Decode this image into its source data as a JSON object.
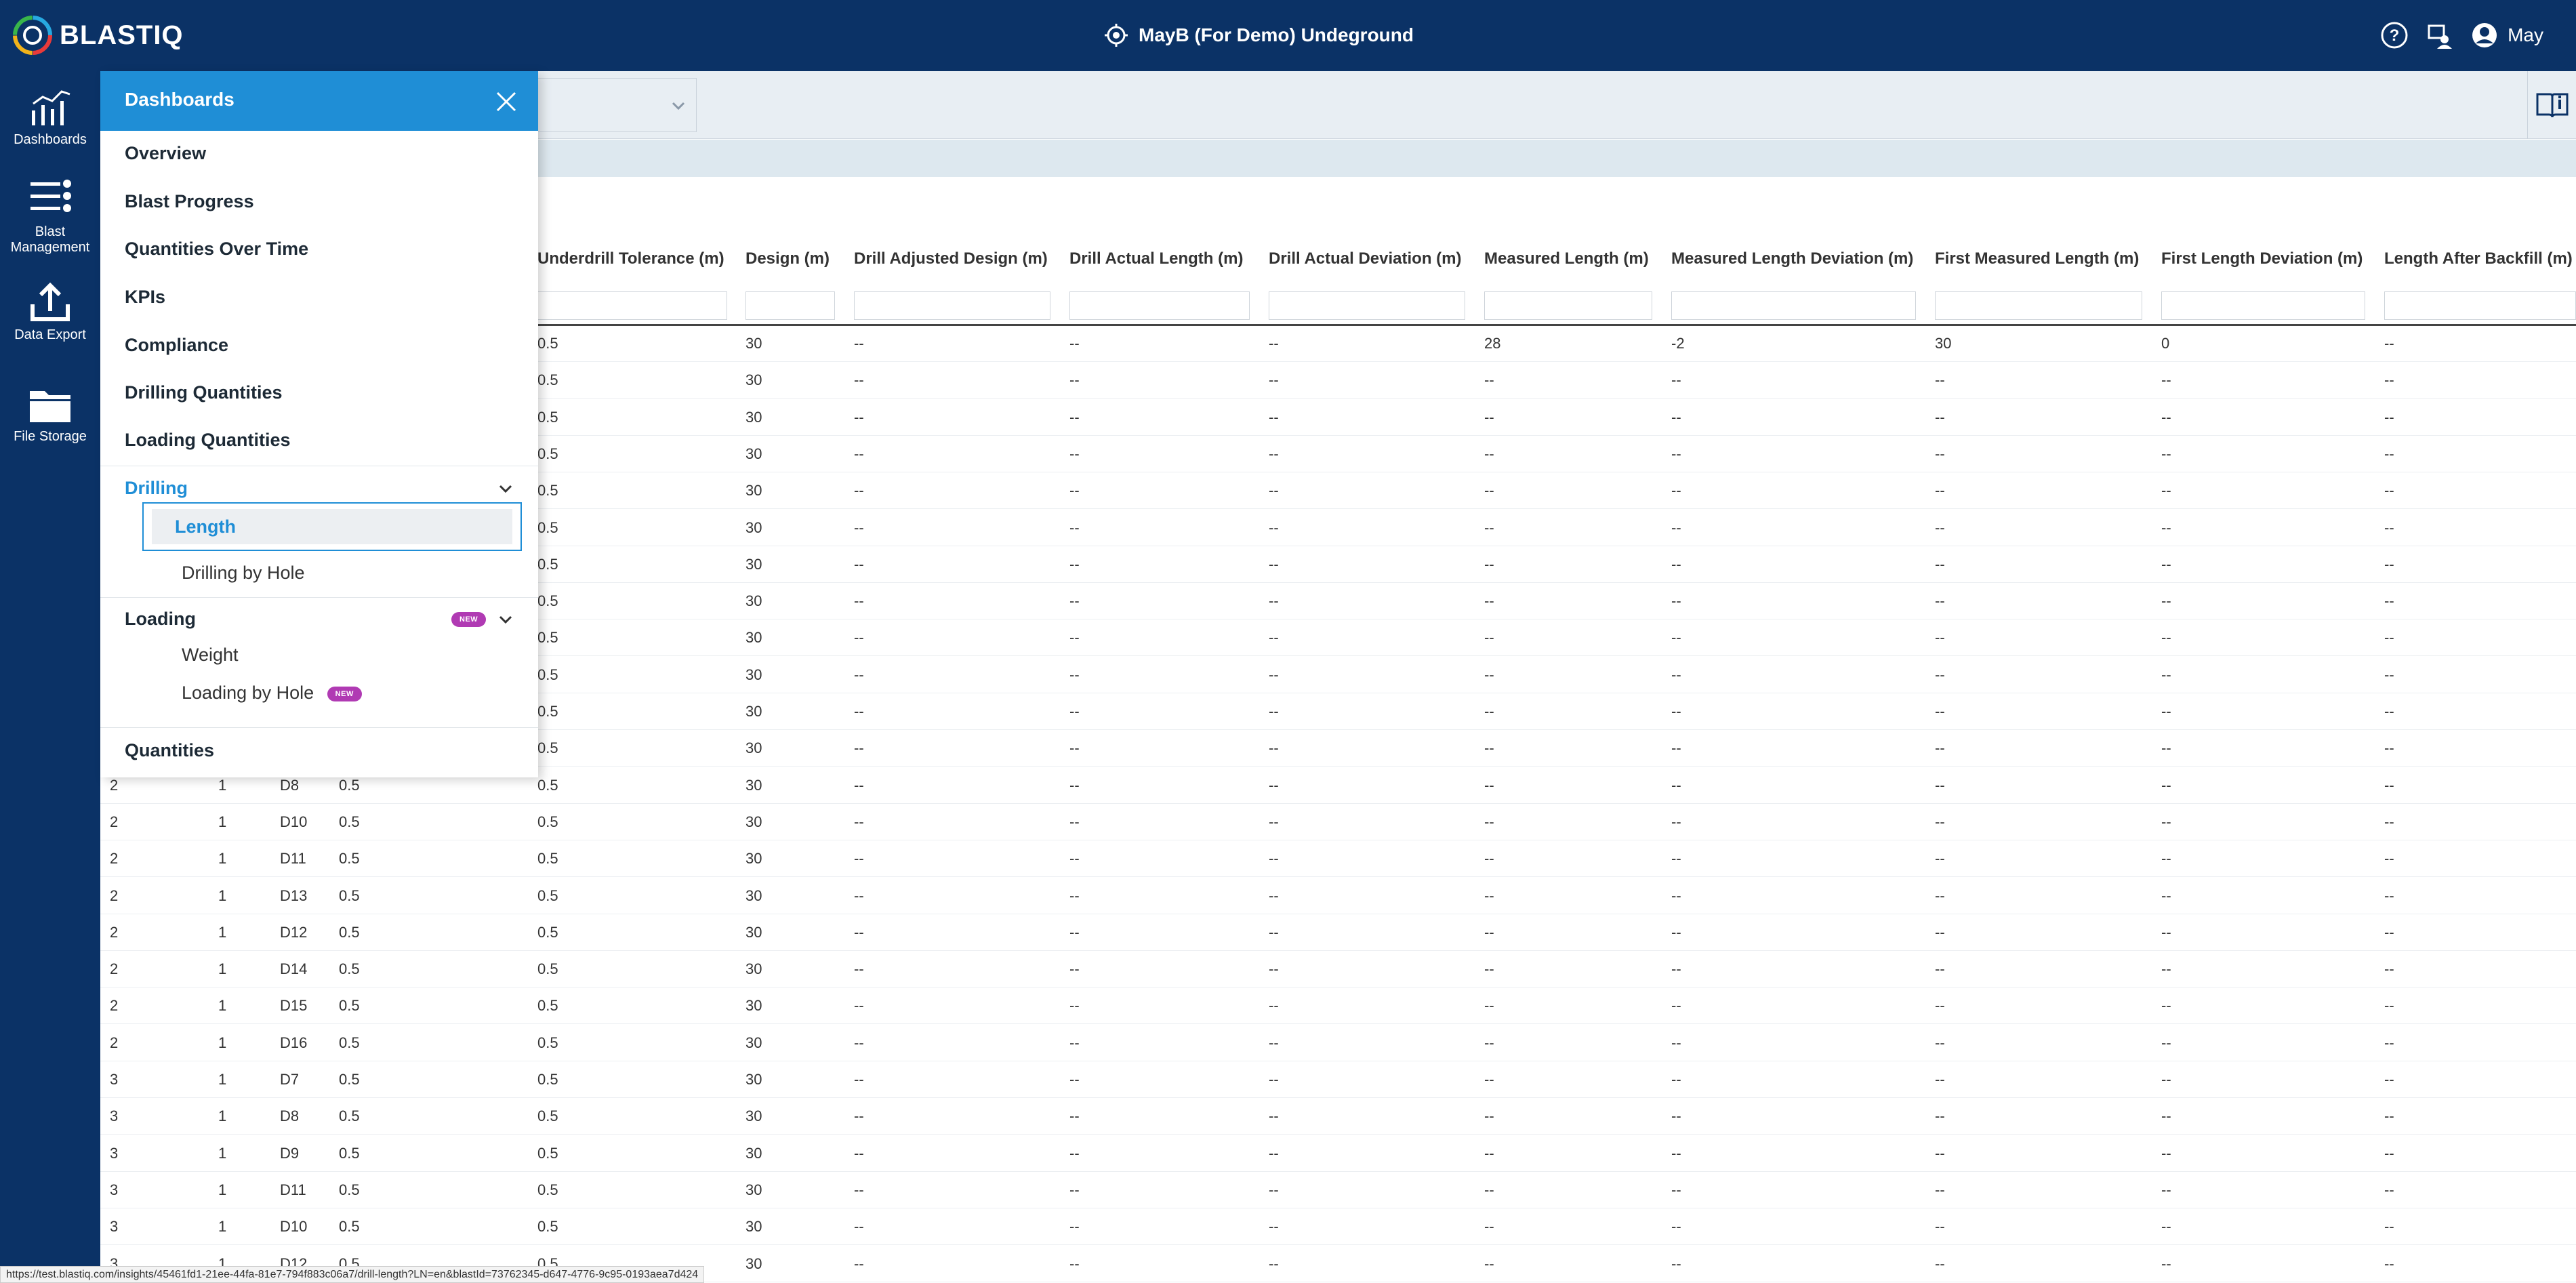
{
  "header": {
    "logo_text": "BLASTIQ",
    "site_name": "MayB (For Demo) Undeground",
    "user_name": "May"
  },
  "rail": {
    "items": [
      {
        "label": "Dashboards"
      },
      {
        "label": "Blast Management"
      },
      {
        "label": "Data Export"
      },
      {
        "label": "File Storage"
      }
    ]
  },
  "panel": {
    "title": "Dashboards",
    "items": {
      "overview": "Overview",
      "blast_progress": "Blast Progress",
      "quantities_over_time": "Quantities Over Time",
      "kpis": "KPIs",
      "compliance": "Compliance",
      "drilling_quantities": "Drilling Quantities",
      "loading_quantities": "Loading Quantities",
      "drilling": "Drilling",
      "length": "Length",
      "drilling_by_hole": "Drilling by Hole",
      "loading": "Loading",
      "weight": "Weight",
      "loading_by_hole": "Loading by Hole",
      "quantities": "Quantities"
    },
    "badge": "NEW"
  },
  "table": {
    "columns": [
      "Underdrill Tolerance (m)",
      "Design (m)",
      "Drill Adjusted Design (m)",
      "Drill Actual Length (m)",
      "Drill Actual Deviation (m)",
      "Measured Length (m)",
      "Measured Length Deviation (m)",
      "First Measured Length (m)",
      "First Length Deviation (m)",
      "Length After Backfill (m)"
    ],
    "rows": [
      {
        "a": "",
        "b": "",
        "c": "",
        "d": "",
        "u": "0.5",
        "v": [
          "30",
          "--",
          "--",
          "--",
          "28",
          "-2",
          "30",
          "0",
          "--"
        ]
      },
      {
        "a": "",
        "b": "",
        "c": "",
        "d": "",
        "u": "0.5",
        "v": [
          "30",
          "--",
          "--",
          "--",
          "--",
          "--",
          "--",
          "--",
          "--"
        ]
      },
      {
        "a": "",
        "b": "",
        "c": "",
        "d": "",
        "u": "0.5",
        "v": [
          "30",
          "--",
          "--",
          "--",
          "--",
          "--",
          "--",
          "--",
          "--"
        ]
      },
      {
        "a": "",
        "b": "",
        "c": "",
        "d": "",
        "u": "0.5",
        "v": [
          "30",
          "--",
          "--",
          "--",
          "--",
          "--",
          "--",
          "--",
          "--"
        ]
      },
      {
        "a": "",
        "b": "",
        "c": "",
        "d": "",
        "u": "0.5",
        "v": [
          "30",
          "--",
          "--",
          "--",
          "--",
          "--",
          "--",
          "--",
          "--"
        ]
      },
      {
        "a": "",
        "b": "",
        "c": "",
        "d": "",
        "u": "0.5",
        "v": [
          "30",
          "--",
          "--",
          "--",
          "--",
          "--",
          "--",
          "--",
          "--"
        ]
      },
      {
        "a": "",
        "b": "",
        "c": "",
        "d": "",
        "u": "0.5",
        "v": [
          "30",
          "--",
          "--",
          "--",
          "--",
          "--",
          "--",
          "--",
          "--"
        ]
      },
      {
        "a": "",
        "b": "",
        "c": "",
        "d": "",
        "u": "0.5",
        "v": [
          "30",
          "--",
          "--",
          "--",
          "--",
          "--",
          "--",
          "--",
          "--"
        ]
      },
      {
        "a": "",
        "b": "",
        "c": "",
        "d": "",
        "u": "0.5",
        "v": [
          "30",
          "--",
          "--",
          "--",
          "--",
          "--",
          "--",
          "--",
          "--"
        ]
      },
      {
        "a": "",
        "b": "",
        "c": "",
        "d": "",
        "u": "0.5",
        "v": [
          "30",
          "--",
          "--",
          "--",
          "--",
          "--",
          "--",
          "--",
          "--"
        ]
      },
      {
        "a": "",
        "b": "",
        "c": "",
        "d": "",
        "u": "0.5",
        "v": [
          "30",
          "--",
          "--",
          "--",
          "--",
          "--",
          "--",
          "--",
          "--"
        ]
      },
      {
        "a": "",
        "b": "",
        "c": "",
        "d": "",
        "u": "0.5",
        "v": [
          "30",
          "--",
          "--",
          "--",
          "--",
          "--",
          "--",
          "--",
          "--"
        ]
      },
      {
        "a": "2",
        "b": "1",
        "c": "D8",
        "d": "0.5",
        "u": "0.5",
        "v": [
          "30",
          "--",
          "--",
          "--",
          "--",
          "--",
          "--",
          "--",
          "--"
        ]
      },
      {
        "a": "2",
        "b": "1",
        "c": "D10",
        "d": "0.5",
        "u": "0.5",
        "v": [
          "30",
          "--",
          "--",
          "--",
          "--",
          "--",
          "--",
          "--",
          "--"
        ]
      },
      {
        "a": "2",
        "b": "1",
        "c": "D11",
        "d": "0.5",
        "u": "0.5",
        "v": [
          "30",
          "--",
          "--",
          "--",
          "--",
          "--",
          "--",
          "--",
          "--"
        ]
      },
      {
        "a": "2",
        "b": "1",
        "c": "D13",
        "d": "0.5",
        "u": "0.5",
        "v": [
          "30",
          "--",
          "--",
          "--",
          "--",
          "--",
          "--",
          "--",
          "--"
        ]
      },
      {
        "a": "2",
        "b": "1",
        "c": "D12",
        "d": "0.5",
        "u": "0.5",
        "v": [
          "30",
          "--",
          "--",
          "--",
          "--",
          "--",
          "--",
          "--",
          "--"
        ]
      },
      {
        "a": "2",
        "b": "1",
        "c": "D14",
        "d": "0.5",
        "u": "0.5",
        "v": [
          "30",
          "--",
          "--",
          "--",
          "--",
          "--",
          "--",
          "--",
          "--"
        ]
      },
      {
        "a": "2",
        "b": "1",
        "c": "D15",
        "d": "0.5",
        "u": "0.5",
        "v": [
          "30",
          "--",
          "--",
          "--",
          "--",
          "--",
          "--",
          "--",
          "--"
        ]
      },
      {
        "a": "2",
        "b": "1",
        "c": "D16",
        "d": "0.5",
        "u": "0.5",
        "v": [
          "30",
          "--",
          "--",
          "--",
          "--",
          "--",
          "--",
          "--",
          "--"
        ]
      },
      {
        "a": "3",
        "b": "1",
        "c": "D7",
        "d": "0.5",
        "u": "0.5",
        "v": [
          "30",
          "--",
          "--",
          "--",
          "--",
          "--",
          "--",
          "--",
          "--"
        ]
      },
      {
        "a": "3",
        "b": "1",
        "c": "D8",
        "d": "0.5",
        "u": "0.5",
        "v": [
          "30",
          "--",
          "--",
          "--",
          "--",
          "--",
          "--",
          "--",
          "--"
        ]
      },
      {
        "a": "3",
        "b": "1",
        "c": "D9",
        "d": "0.5",
        "u": "0.5",
        "v": [
          "30",
          "--",
          "--",
          "--",
          "--",
          "--",
          "--",
          "--",
          "--"
        ]
      },
      {
        "a": "3",
        "b": "1",
        "c": "D11",
        "d": "0.5",
        "u": "0.5",
        "v": [
          "30",
          "--",
          "--",
          "--",
          "--",
          "--",
          "--",
          "--",
          "--"
        ]
      },
      {
        "a": "3",
        "b": "1",
        "c": "D10",
        "d": "0.5",
        "u": "0.5",
        "v": [
          "30",
          "--",
          "--",
          "--",
          "--",
          "--",
          "--",
          "--",
          "--"
        ]
      },
      {
        "a": "3",
        "b": "1",
        "c": "D12",
        "d": "0.5",
        "u": "0.5",
        "v": [
          "30",
          "--",
          "--",
          "--",
          "--",
          "--",
          "--",
          "--",
          "--"
        ]
      }
    ]
  },
  "status_url": "https://test.blastiq.com/insights/45461fd1-21ee-44fa-81e7-794f883c06a7/drill-length?LN=en&blastId=73762345-d647-4776-9c95-0193aea7d424",
  "colors": {
    "navy": "#0b3266",
    "accent_blue": "#1f8ed6",
    "new_badge": "#b03ab3"
  },
  "icons": [
    "blastiq-logo-icon",
    "location-target-icon",
    "help-icon",
    "switch-user-icon",
    "user-avatar-icon",
    "dashboards-icon",
    "blast-management-icon",
    "data-export-icon",
    "file-storage-icon",
    "close-icon",
    "chevron-down-icon",
    "book-info-icon"
  ]
}
